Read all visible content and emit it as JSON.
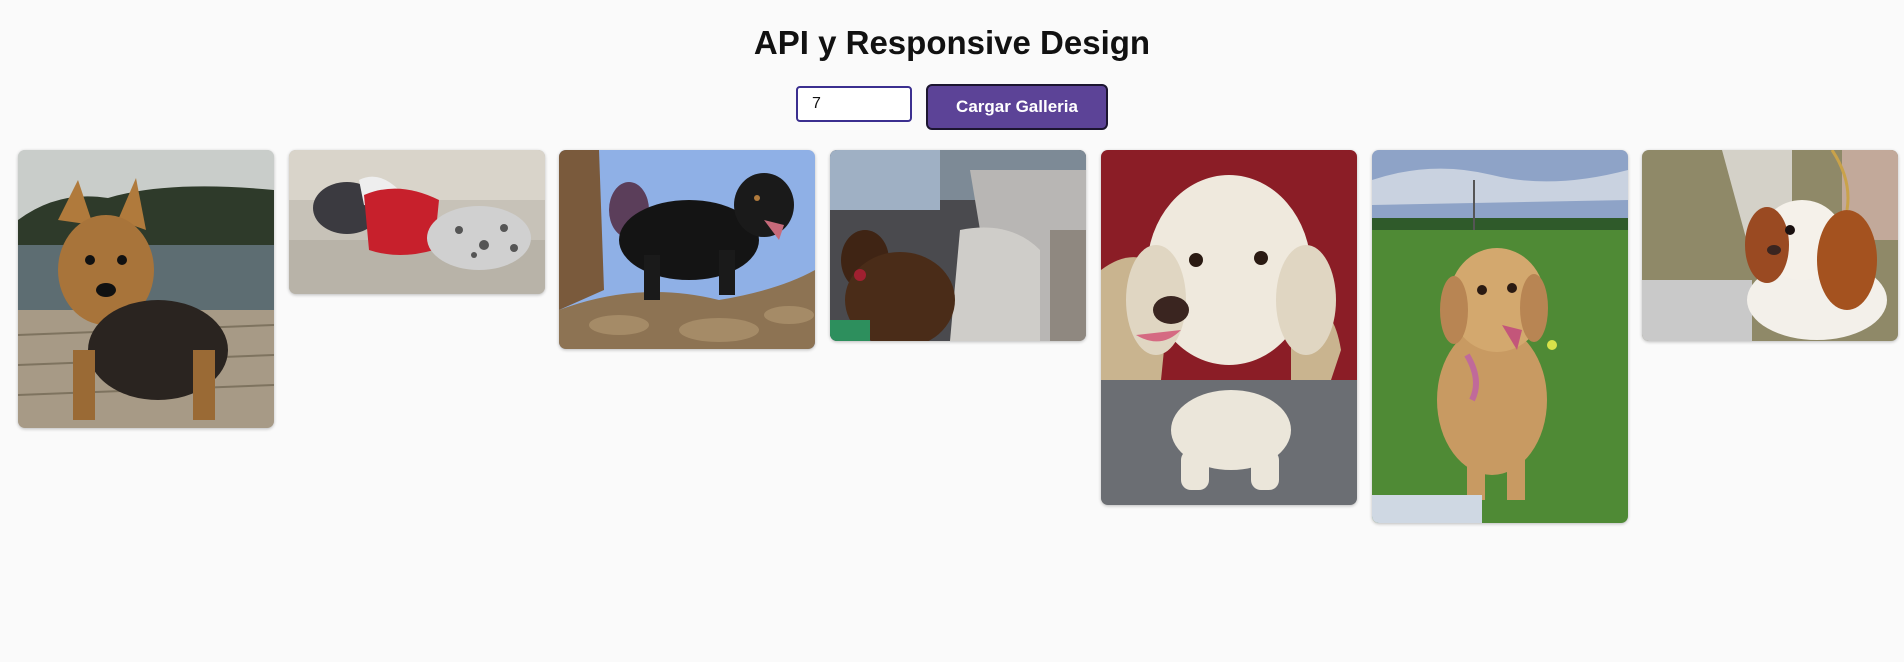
{
  "page": {
    "title": "API y Responsive Design"
  },
  "controls": {
    "count_value": "7",
    "load_button_label": "Cargar Galleria"
  },
  "gallery": {
    "images": [
      {
        "subject": "dog-photo",
        "alt": "Australian terrier on a dock"
      },
      {
        "subject": "dog-photo",
        "alt": "Shar pei in a red sweater"
      },
      {
        "subject": "dog-photo",
        "alt": "Tibetan mastiff on a rock"
      },
      {
        "subject": "dog-photo",
        "alt": "Chocolate labrador in a car"
      },
      {
        "subject": "dog-photo",
        "alt": "Cream cockapoo sitting"
      },
      {
        "subject": "dog-photo",
        "alt": "Golden retriever on grass"
      },
      {
        "subject": "dog-photo",
        "alt": "Cavalier King Charles spaniel"
      }
    ]
  },
  "colors": {
    "accent": "#5c4397",
    "background": "#fafafa"
  }
}
